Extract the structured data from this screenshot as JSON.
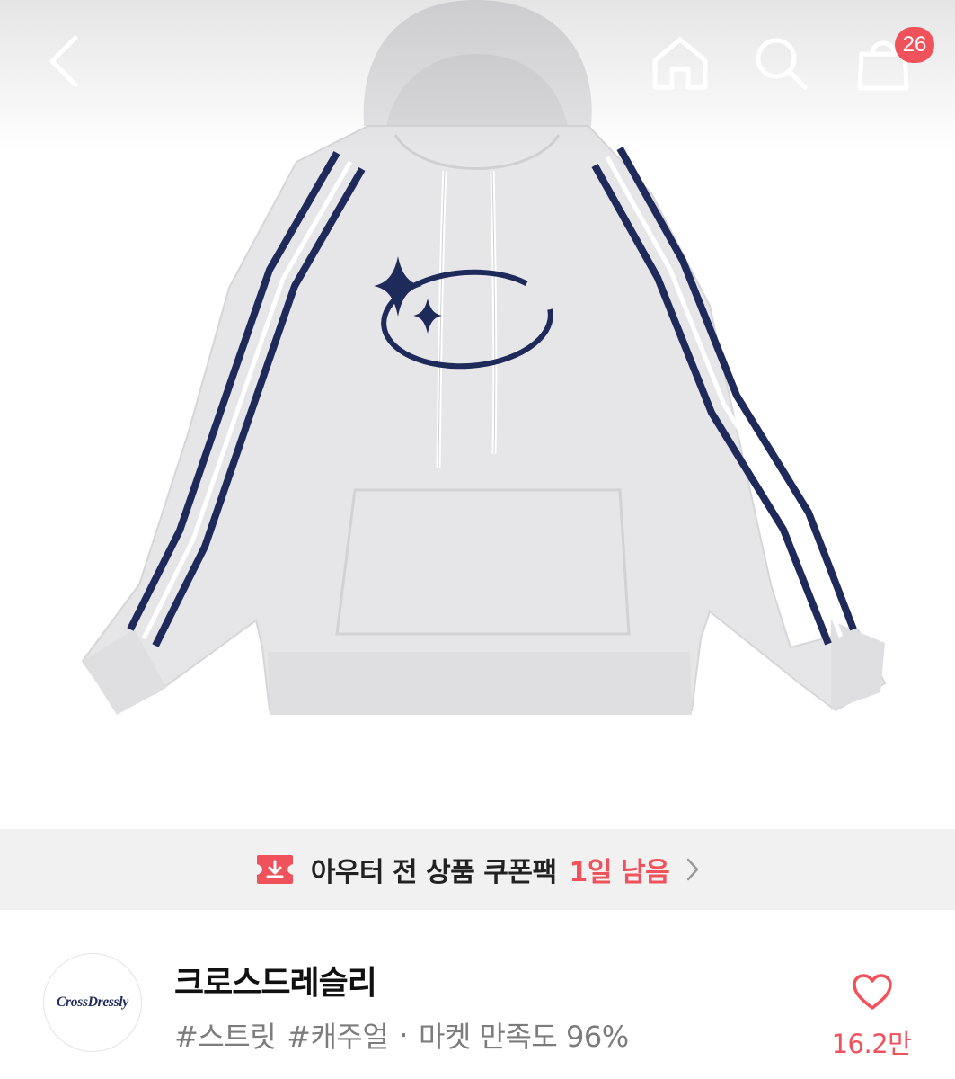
{
  "nav": {
    "back_icon": "chevron-left-icon",
    "home_icon": "home-icon",
    "search_icon": "search-icon",
    "cart_icon": "shopping-bag-icon",
    "cart_badge": "26"
  },
  "product_image": {
    "logo_icon": "sparkle-orbit-logo"
  },
  "coupon": {
    "icon": "coupon-download-icon",
    "text": "아우터 전 상품 쿠폰팩",
    "remaining": "1일 남음",
    "chevron_icon": "chevron-right-icon"
  },
  "store": {
    "logo_text": "CrossDressly",
    "name": "크로스드레슬리",
    "tags": [
      "#스트릿",
      "#캐주얼"
    ],
    "separator": "·",
    "satisfaction": "마켓 만족도 96%",
    "favorite_icon": "heart-outline-icon",
    "favorite_count": "16.2만"
  },
  "colors": {
    "accent": "#f0525c",
    "navy": "#1e2a5a",
    "hoodie": "#e6e6e8",
    "banner_bg": "#f1f1f2"
  }
}
